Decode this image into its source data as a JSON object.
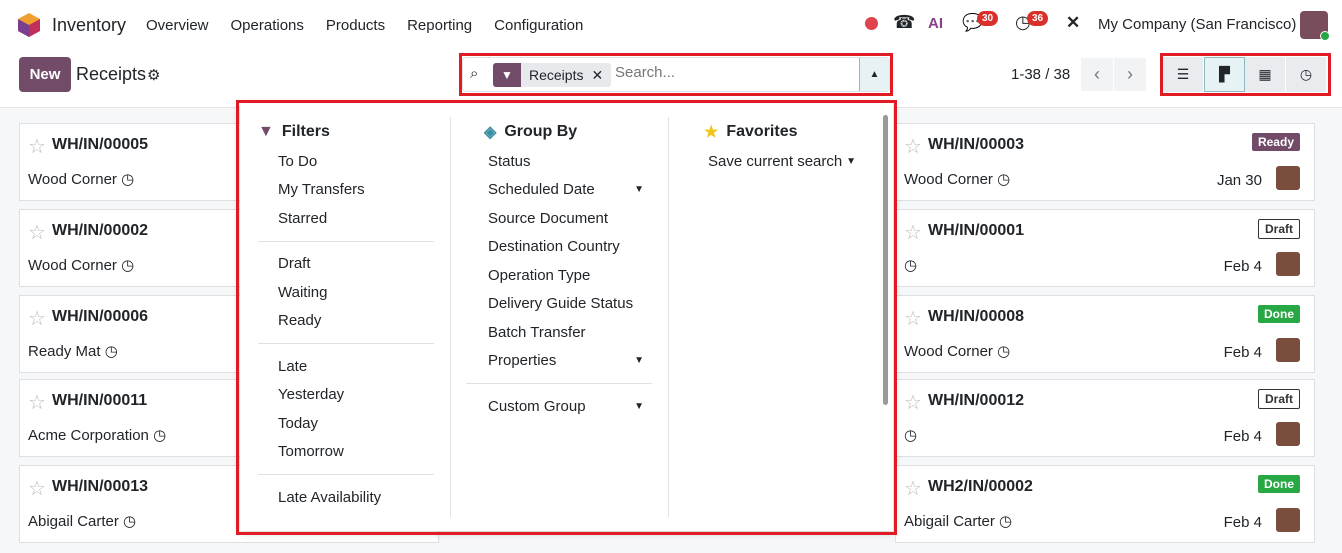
{
  "nav": {
    "app": "Inventory",
    "menu": [
      "Overview",
      "Operations",
      "Products",
      "Reporting",
      "Configuration"
    ],
    "ai": "AI",
    "messages_count": "30",
    "activities_count": "36",
    "company": "My Company (San Francisco)"
  },
  "control": {
    "new_label": "New",
    "title": "Receipts",
    "facet": "Receipts",
    "search_placeholder": "Search...",
    "pager": "1-38 / 38"
  },
  "cards": [
    {
      "ref": "WH/IN/00005",
      "partner": "Wood Corner",
      "status": "",
      "date": ""
    },
    {
      "ref": "WH/IN/00002",
      "partner": "Wood Corner",
      "status": "",
      "date": ""
    },
    {
      "ref": "WH/IN/00006",
      "partner": "Ready Mat",
      "status": "",
      "date": ""
    },
    {
      "ref": "WH/IN/00011",
      "partner": "Acme Corporation",
      "status": "",
      "date": ""
    },
    {
      "ref": "WH/IN/00013",
      "partner": "Abigail Carter",
      "status": "",
      "date": ""
    },
    {
      "ref": "WH/IN/00003",
      "partner": "Wood Corner",
      "status": "Ready",
      "date": "Jan 30"
    },
    {
      "ref": "WH/IN/00001",
      "partner": "",
      "status": "Draft",
      "date": "Feb 4"
    },
    {
      "ref": "WH/IN/00008",
      "partner": "Wood Corner",
      "status": "Done",
      "date": "Feb 4"
    },
    {
      "ref": "WH/IN/00012",
      "partner": "",
      "status": "Draft",
      "date": "Feb 4"
    },
    {
      "ref": "WH2/IN/00002",
      "partner": "Abigail Carter",
      "status": "Done",
      "date": "Feb 4"
    }
  ],
  "dropdown": {
    "filters": {
      "title": "Filters",
      "groups": [
        [
          "To Do",
          "My Transfers",
          "Starred"
        ],
        [
          "Draft",
          "Waiting",
          "Ready"
        ],
        [
          "Late",
          "Yesterday",
          "Today",
          "Tomorrow"
        ],
        [
          "Late Availability"
        ]
      ]
    },
    "group_by": {
      "title": "Group By",
      "items": [
        "Status",
        "Scheduled Date",
        "Source Document",
        "Destination Country",
        "Operation Type",
        "Delivery Guide Status",
        "Batch Transfer",
        "Properties"
      ],
      "custom": "Custom Group"
    },
    "favorites": {
      "title": "Favorites",
      "save": "Save current search"
    }
  }
}
